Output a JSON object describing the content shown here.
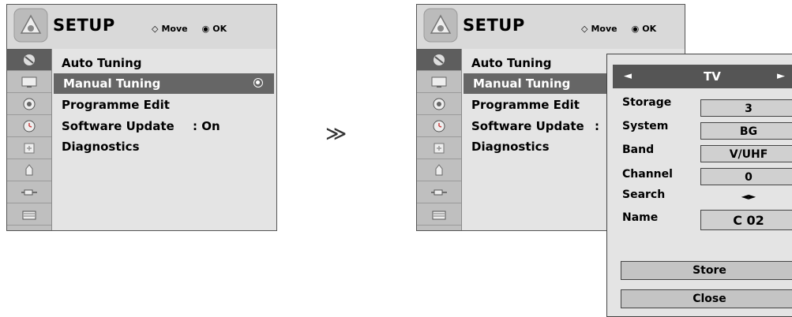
{
  "left_menu": {
    "title": "SETUP",
    "nav_move": "Move",
    "nav_ok": "OK",
    "items": [
      {
        "label": "Auto Tuning",
        "value": ""
      },
      {
        "label": "Manual Tuning",
        "value": ""
      },
      {
        "label": "Programme Edit",
        "value": ""
      },
      {
        "label": "Software Update",
        "value": ": On"
      },
      {
        "label": "Diagnostics",
        "value": ""
      }
    ],
    "selected_index": 1
  },
  "arrow": "≫",
  "right_menu": {
    "title": "SETUP",
    "nav_move": "Move",
    "nav_ok": "OK",
    "items": [
      {
        "label": "Auto Tuning",
        "value": ""
      },
      {
        "label": "Manual Tuning",
        "value": ""
      },
      {
        "label": "Programme Edit",
        "value": ""
      },
      {
        "label": "Software Update",
        "value": ":"
      },
      {
        "label": "Diagnostics",
        "value": ""
      }
    ],
    "selected_index": 1
  },
  "popup": {
    "header": {
      "left_arrow": "◄",
      "label": "TV",
      "right_arrow": "►"
    },
    "fields": {
      "storage": {
        "label": "Storage",
        "value": "3"
      },
      "system": {
        "label": "System",
        "value": "BG"
      },
      "band": {
        "label": "Band",
        "value": "V/UHF"
      },
      "channel": {
        "label": "Channel",
        "value": "0"
      },
      "search": {
        "label": "Search",
        "value": "◄►"
      },
      "name": {
        "label": "Name",
        "value": "C  02"
      }
    },
    "store_label": "Store",
    "close_label": "Close"
  },
  "icons": [
    "tv-icon",
    "picture-icon",
    "audio-icon",
    "time-icon",
    "lock-icon",
    "option-icon",
    "input-icon",
    "usb-icon"
  ],
  "colors": {
    "menu_bg": "#d9d9d9",
    "selected_bg": "#666666",
    "icon_col_bg": "#bfbfbf"
  }
}
